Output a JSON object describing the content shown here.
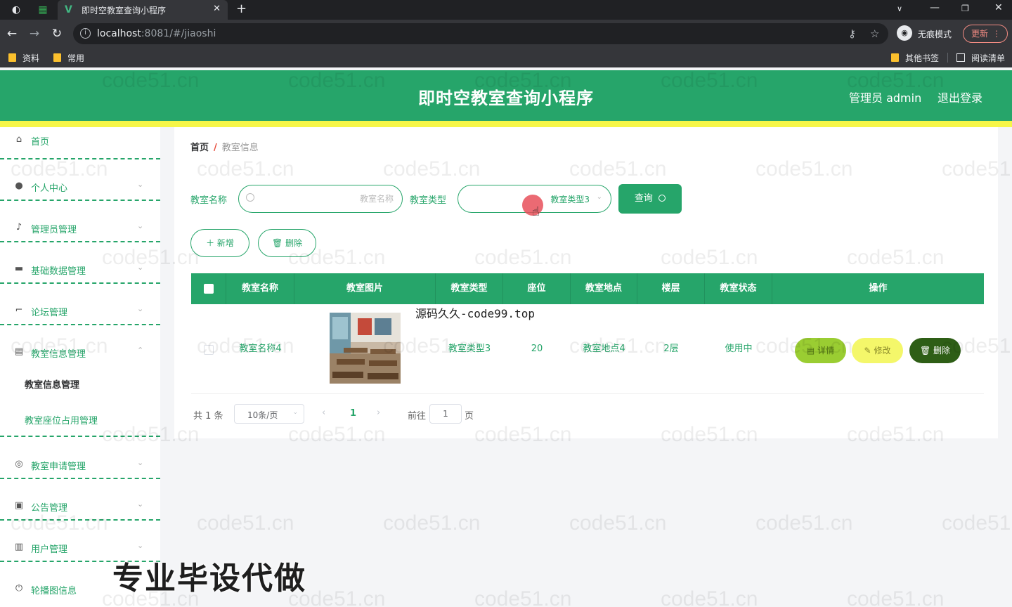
{
  "browser": {
    "tab_title": "即时空教室查询小程序",
    "url_host": "localhost",
    "url_rest": ":8081/#/jiaoshi",
    "incognito_label": "无痕模式",
    "update_label": "更新",
    "bookmarks": [
      "资料",
      "常用"
    ],
    "other_bookmarks": "其他书签",
    "reading_list": "阅读清单"
  },
  "header": {
    "title": "即时空教室查询小程序",
    "admin_label": "管理员 admin",
    "logout_label": "退出登录"
  },
  "sidebar": {
    "items": [
      {
        "label": "首页",
        "icon": "home-icon"
      },
      {
        "label": "个人中心",
        "icon": "user-icon"
      },
      {
        "label": "管理员管理",
        "icon": "mic-icon"
      },
      {
        "label": "基础数据管理",
        "icon": "box-icon"
      },
      {
        "label": "论坛管理",
        "icon": "crop-icon"
      },
      {
        "label": "教室信息管理",
        "icon": "chat-icon"
      },
      {
        "label": "教室申请管理",
        "icon": "compass-icon"
      },
      {
        "label": "公告管理",
        "icon": "ticket-icon"
      },
      {
        "label": "用户管理",
        "icon": "printer-icon"
      },
      {
        "label": "轮播图信息",
        "icon": "power-icon"
      }
    ],
    "sub_items": [
      "教室信息管理",
      "教室座位占用管理"
    ]
  },
  "breadcrumb": {
    "home": "首页",
    "separator": "/",
    "current": "教室信息"
  },
  "search": {
    "name_label": "教室名称",
    "name_placeholder": "教室名称",
    "type_label": "教室类型",
    "type_value": "教室类型3",
    "query_label": "查询"
  },
  "actions": {
    "add_label": "新增",
    "delete_label": "删除"
  },
  "table": {
    "columns": [
      "教室名称",
      "教室图片",
      "教室类型",
      "座位",
      "教室地点",
      "楼层",
      "教室状态",
      "操作"
    ],
    "rows": [
      {
        "name": "教室名称4",
        "type": "教室类型3",
        "seats": "20",
        "location": "教室地点4",
        "floor": "2层",
        "status": "使用中"
      }
    ],
    "row_actions": {
      "detail": "详情",
      "edit": "修改",
      "delete": "删除"
    }
  },
  "pagination": {
    "total": "共 1 条",
    "page_size": "10条/页",
    "current_page": "1",
    "goto_label": "前往",
    "goto_value": "1",
    "page_suffix": "页"
  },
  "overlay": {
    "source_line": "源码久久-code99.top",
    "promo": "专业毕设代做",
    "watermark": "code51.cn"
  },
  "colors": {
    "primary": "#26a56a",
    "stripe": "#f6f648",
    "detail_btn": "#9acd32",
    "edit_btn": "#f4f76a",
    "delete_btn": "#2e5e16"
  }
}
